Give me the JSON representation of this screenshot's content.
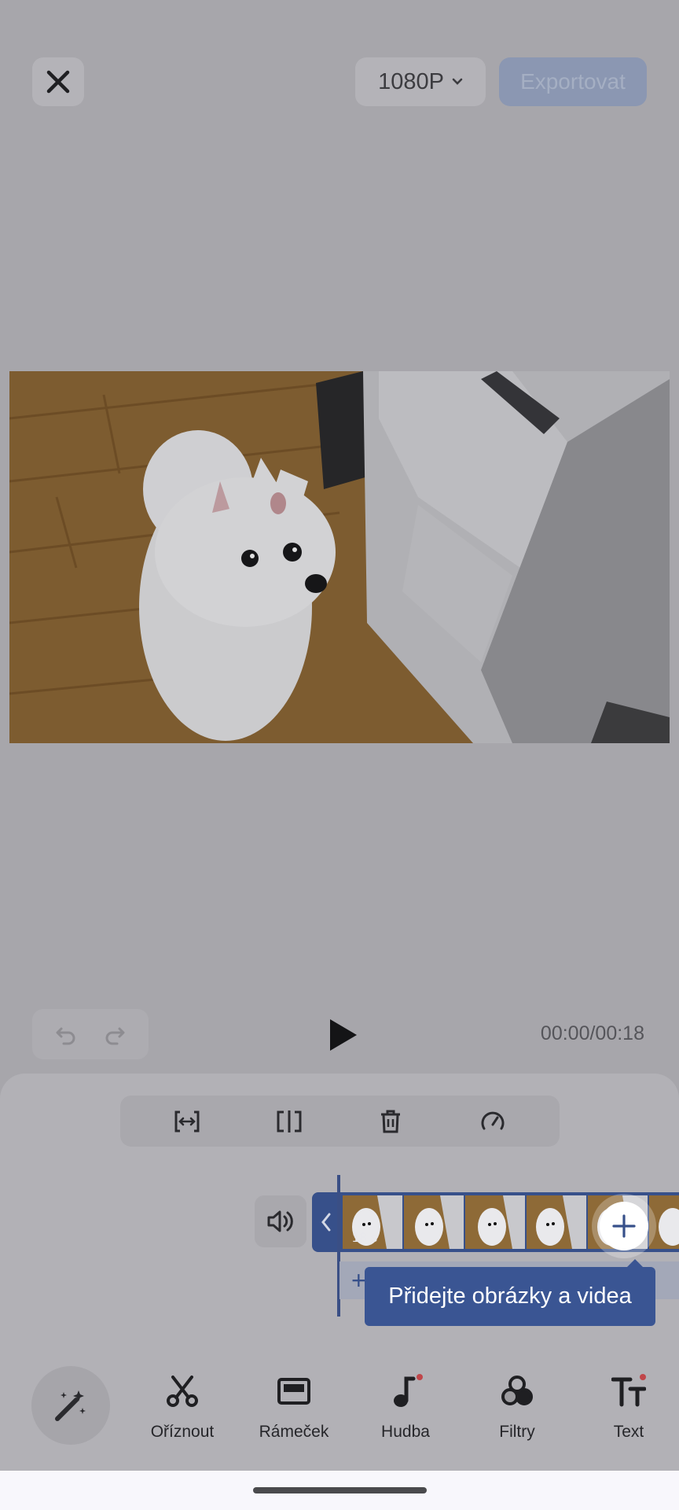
{
  "header": {
    "close_icon": "close-icon",
    "resolution_label": "1080P",
    "export_label": "Exportovat"
  },
  "player": {
    "timecode": "00:00/00:18"
  },
  "timeline": {
    "clip_duration": "18 s",
    "tooltip": "Přidejte obrázky a videa"
  },
  "bottom_nav": {
    "items": [
      {
        "label": "Oříznout",
        "icon": "scissors-icon"
      },
      {
        "label": "Rámeček",
        "icon": "frame-icon"
      },
      {
        "label": "Hudba",
        "icon": "music-note-icon"
      },
      {
        "label": "Filtry",
        "icon": "filters-icon"
      },
      {
        "label": "Text",
        "icon": "text-icon"
      }
    ]
  },
  "colors": {
    "accent": "#37508a",
    "overlay_bg": "#a7a6ab"
  }
}
